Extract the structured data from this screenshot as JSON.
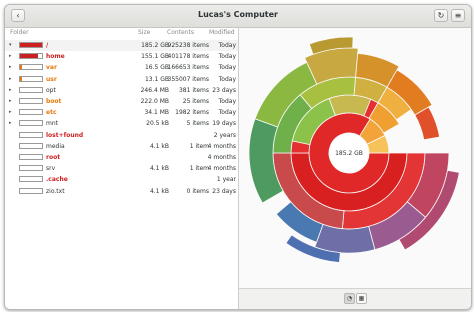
{
  "window": {
    "title": "Lucas's Computer"
  },
  "colors": {
    "red": "#cc1f1f",
    "orange": "#e8760a",
    "accent_root": "#e33b3b"
  },
  "columns": {
    "folder": "Folder",
    "size": "Size",
    "contents": "Contents",
    "modified": "Modified"
  },
  "rows": [
    {
      "name": "/",
      "size": "185.2 GB",
      "contents": "925238 items",
      "modified": "Today",
      "expander": "▾",
      "color": "#cc1f1f",
      "fill": 1.0
    },
    {
      "name": "home",
      "size": "155.1 GB",
      "contents": "401178 items",
      "modified": "Today",
      "expander": "▸",
      "color": "#cc1f1f",
      "fill": 0.84
    },
    {
      "name": "var",
      "size": "16.5 GB",
      "contents": "166653 items",
      "modified": "Today",
      "expander": "▸",
      "color": "#e8760a",
      "fill": 0.09
    },
    {
      "name": "usr",
      "size": "13.1 GB",
      "contents": "355007 items",
      "modified": "Today",
      "expander": "▸",
      "color": "#e8760a",
      "fill": 0.07
    },
    {
      "name": "opt",
      "size": "246.4 MB",
      "contents": "381 items",
      "modified": "23 days",
      "expander": "▸",
      "color": "#2e3436",
      "fill": 0.0
    },
    {
      "name": "boot",
      "size": "222.0 MB",
      "contents": "25 items",
      "modified": "Today",
      "expander": "▸",
      "color": "#e8760a",
      "fill": 0.0
    },
    {
      "name": "etc",
      "size": "34.1 MB",
      "contents": "1982 items",
      "modified": "Today",
      "expander": "▸",
      "color": "#e8760a",
      "fill": 0.0
    },
    {
      "name": "mnt",
      "size": "20.5 kB",
      "contents": "5 items",
      "modified": "19 days",
      "expander": "▸",
      "color": "#2e3436",
      "fill": 0.0
    },
    {
      "name": "lost+found",
      "size": "",
      "contents": "",
      "modified": "2 years",
      "expander": "",
      "color": "#cc1f1f",
      "fill": 0.0
    },
    {
      "name": "media",
      "size": "4.1 kB",
      "contents": "1 item",
      "modified": "4 months",
      "expander": "",
      "color": "#2e3436",
      "fill": 0.0
    },
    {
      "name": "root",
      "size": "",
      "contents": "",
      "modified": "4 months",
      "expander": "",
      "color": "#cc1f1f",
      "fill": 0.0
    },
    {
      "name": "srv",
      "size": "4.1 kB",
      "contents": "1 item",
      "modified": "4 months",
      "expander": "",
      "color": "#2e3436",
      "fill": 0.0
    },
    {
      "name": ".cache",
      "size": "",
      "contents": "",
      "modified": "1 year",
      "expander": "",
      "color": "#cc1f1f",
      "fill": 0.0
    },
    {
      "name": "zio.txt",
      "size": "4.1 kB",
      "contents": "0 items",
      "modified": "23 days",
      "expander": "",
      "color": "#2e3436",
      "fill": 0.0
    }
  ],
  "chart": {
    "center_label": "185.2 GB",
    "ring1": [
      {
        "frac": 0.84,
        "color": "#e02828"
      },
      {
        "frac": 0.09,
        "color": "#f0a030"
      },
      {
        "frac": 0.07,
        "color": "#8bc34a"
      }
    ]
  },
  "icons": {
    "back": "chevron-left-icon",
    "refresh": "refresh-icon",
    "menu": "hamburger-menu-icon"
  }
}
